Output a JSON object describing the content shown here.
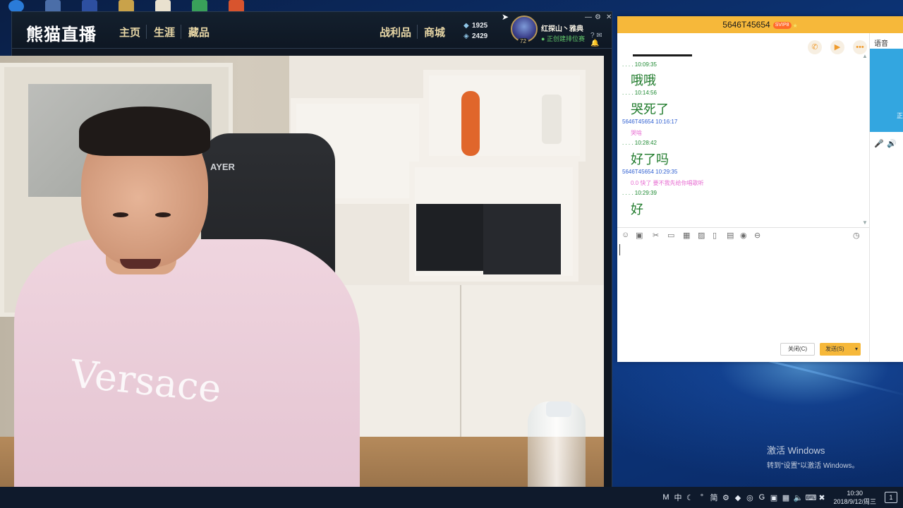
{
  "panda": {
    "logo": "熊猫直播",
    "nav": [
      "主页",
      "生涯",
      "藏品"
    ],
    "nav_right": [
      "战利品",
      "商城"
    ],
    "currency_a": "1925",
    "currency_b": "2429",
    "user_name": "红探山丶雅典",
    "user_status": "正创建排位赛",
    "level": "72"
  },
  "chat": {
    "title": "5646T45654",
    "badge": "SVIP8",
    "side_title": "语音",
    "side_blue_text": "正",
    "messages": [
      {
        "meta": ". . . .      10:09:35",
        "text": "哦哦",
        "kind": "self"
      },
      {
        "meta": ". . . .      10:14:56",
        "text": "哭死了",
        "kind": "self"
      },
      {
        "meta": "5646T45654   10:16:17",
        "text": "哭啥",
        "kind": "other"
      },
      {
        "meta": ". . . .      10:28:42",
        "text": "好了吗",
        "kind": "self"
      },
      {
        "meta": "5646T45654   10:29:35",
        "text": "0.0 快了  要不我先给你唱歌听",
        "kind": "other"
      },
      {
        "meta": ". . . .      10:29:39",
        "text": "好",
        "kind": "self"
      }
    ],
    "close_label": "关闭(C)",
    "send_label": "发送(S)"
  },
  "desktop": {
    "activate_line1": "激活 Windows",
    "activate_line2": "转到\"设置\"以激活 Windows。"
  },
  "taskbar": {
    "ime": "中",
    "simplified": "简",
    "time": "10:30",
    "date": "2018/9/12/周三",
    "notif": "1"
  },
  "video": {
    "shirt_text": "Versace",
    "chair_text": "AYER"
  }
}
